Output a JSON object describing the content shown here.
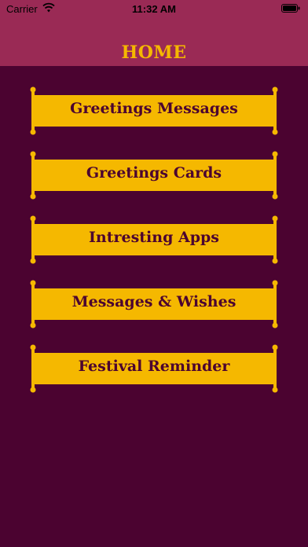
{
  "status_bar": {
    "carrier": "Carrier",
    "time": "11:32 AM",
    "icons": [
      "wifi-icon",
      "battery-icon"
    ]
  },
  "header": {
    "title": "HOME"
  },
  "menu": {
    "items": [
      {
        "label": "Greetings Messages"
      },
      {
        "label": "Greetings Cards"
      },
      {
        "label": "Intresting Apps"
      },
      {
        "label": "Messages & Wishes"
      },
      {
        "label": "Festival Reminder"
      }
    ]
  },
  "colors": {
    "background": "#4b0330",
    "header": "#9a2a55",
    "accent": "#f5b800"
  }
}
